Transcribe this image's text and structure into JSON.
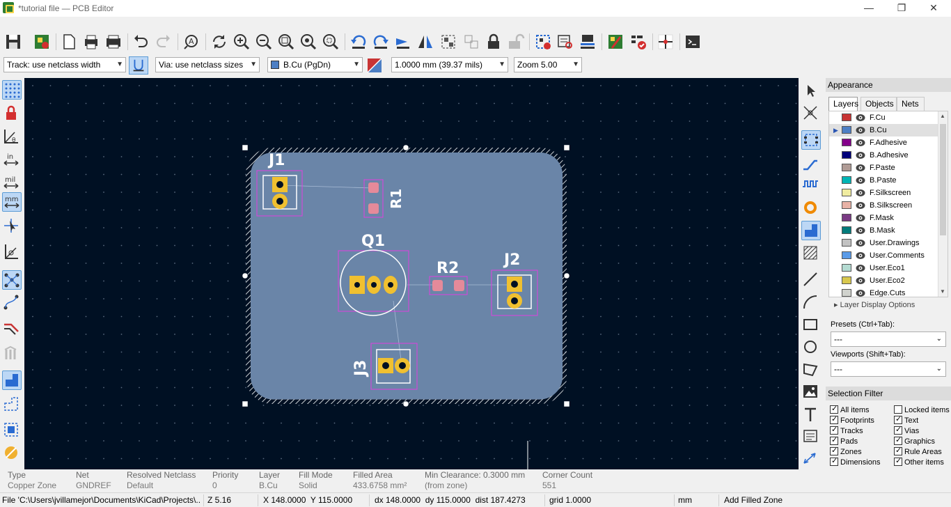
{
  "window": {
    "title": "*tutorial file — PCB Editor",
    "minimize_glyph": "—",
    "maximize_glyph": "❐",
    "close_glyph": "✕"
  },
  "main_toolbar": {
    "icons": [
      "save-icon",
      "board-setup-icon",
      "new-page-icon",
      "print-icon",
      "plot-icon",
      "undo-icon",
      "redo-icon",
      "find-icon",
      "refresh-icon",
      "zoom-in-icon",
      "zoom-out-icon",
      "zoom-fit-icon",
      "zoom-objects-icon",
      "zoom-selection-icon",
      "rotate-ccw-icon",
      "rotate-cw-icon",
      "flip-icon",
      "mirror-icon",
      "group-icon",
      "ungroup-icon",
      "lock-icon",
      "unlock-icon",
      "footprint-editor-icon",
      "footprint-browser-icon",
      "load-footprint-icon",
      "update-pcb-icon",
      "drc-icon",
      "autoroute-icon",
      "scripting-console-icon"
    ]
  },
  "aux_toolbar": {
    "track_width": "Track: use netclass width",
    "via_size": "Via: use netclass sizes",
    "active_layer": "B.Cu (PgDn)",
    "grid": "1.0000 mm (39.37 mils)",
    "zoom": "Zoom 5.00"
  },
  "canvas": {
    "refs": {
      "j1": "J1",
      "r1": "R1",
      "q1": "Q1",
      "r2": "R2",
      "j2": "J2",
      "j3": "J3"
    },
    "colors": {
      "background": "#001023",
      "board": "#6a85a8",
      "pad": "#f0c030",
      "smd_pad": "#e58a9a",
      "courtyard": "#e040e0",
      "silk": "#ffffff"
    }
  },
  "appearance": {
    "header": "Appearance",
    "tabs": [
      "Layers",
      "Objects",
      "Nets"
    ],
    "layers": [
      {
        "name": "F.Cu",
        "color": "#c83434"
      },
      {
        "name": "B.Cu",
        "color": "#4d7fc4"
      },
      {
        "name": "F.Adhesive",
        "color": "#84008a"
      },
      {
        "name": "B.Adhesive",
        "color": "#00007a"
      },
      {
        "name": "F.Paste",
        "color": "#b09c96"
      },
      {
        "name": "B.Paste",
        "color": "#00b5b5"
      },
      {
        "name": "F.Silkscreen",
        "color": "#f0eca0"
      },
      {
        "name": "B.Silkscreen",
        "color": "#e8b2a6"
      },
      {
        "name": "F.Mask",
        "color": "#7a3a84"
      },
      {
        "name": "B.Mask",
        "color": "#027b7b"
      },
      {
        "name": "User.Drawings",
        "color": "#c2c2c2"
      },
      {
        "name": "User.Comments",
        "color": "#5a9be8"
      },
      {
        "name": "User.Eco1",
        "color": "#b4dbd2"
      },
      {
        "name": "User.Eco2",
        "color": "#d8c84e"
      },
      {
        "name": "Edge.Cuts",
        "color": "#d0d2cd"
      }
    ],
    "layer_display_options": "Layer Display Options",
    "presets_label": "Presets (Ctrl+Tab):",
    "presets_value": "---",
    "viewports_label": "Viewports (Shift+Tab):",
    "viewports_value": "---"
  },
  "selection_filter": {
    "header": "Selection Filter",
    "items": [
      {
        "label": "All items",
        "checked": true
      },
      {
        "label": "Locked items",
        "checked": false
      },
      {
        "label": "Footprints",
        "checked": true
      },
      {
        "label": "Text",
        "checked": true
      },
      {
        "label": "Tracks",
        "checked": true
      },
      {
        "label": "Vias",
        "checked": true
      },
      {
        "label": "Pads",
        "checked": true
      },
      {
        "label": "Graphics",
        "checked": true
      },
      {
        "label": "Zones",
        "checked": true
      },
      {
        "label": "Rule Areas",
        "checked": true
      },
      {
        "label": "Dimensions",
        "checked": true
      },
      {
        "label": "Other items",
        "checked": true
      }
    ]
  },
  "message_panel": [
    {
      "label": "Type",
      "value": "Copper Zone"
    },
    {
      "label": "Net",
      "value": "GNDREF"
    },
    {
      "label": "Resolved Netclass",
      "value": "Default"
    },
    {
      "label": "Priority",
      "value": "0"
    },
    {
      "label": "Layer",
      "value": "B.Cu"
    },
    {
      "label": "Fill Mode",
      "value": "Solid"
    },
    {
      "label": "Filled Area",
      "value": "433.6758 mm²"
    },
    {
      "label": "Min Clearance: 0.3000 mm",
      "value": "(from zone)"
    },
    {
      "label": "Corner Count",
      "value": "551"
    }
  ],
  "status_bar": {
    "file": "File 'C:\\Users\\jvillamejor\\Documents\\KiCad\\Projects\\...",
    "zoom": "Z 5.16",
    "xy": "X 148.0000  Y 115.0000",
    "delta": "dx 148.0000  dy 115.0000  dist 187.4273",
    "grid": "grid 1.0000",
    "units": "mm",
    "action": "Add Filled Zone"
  }
}
